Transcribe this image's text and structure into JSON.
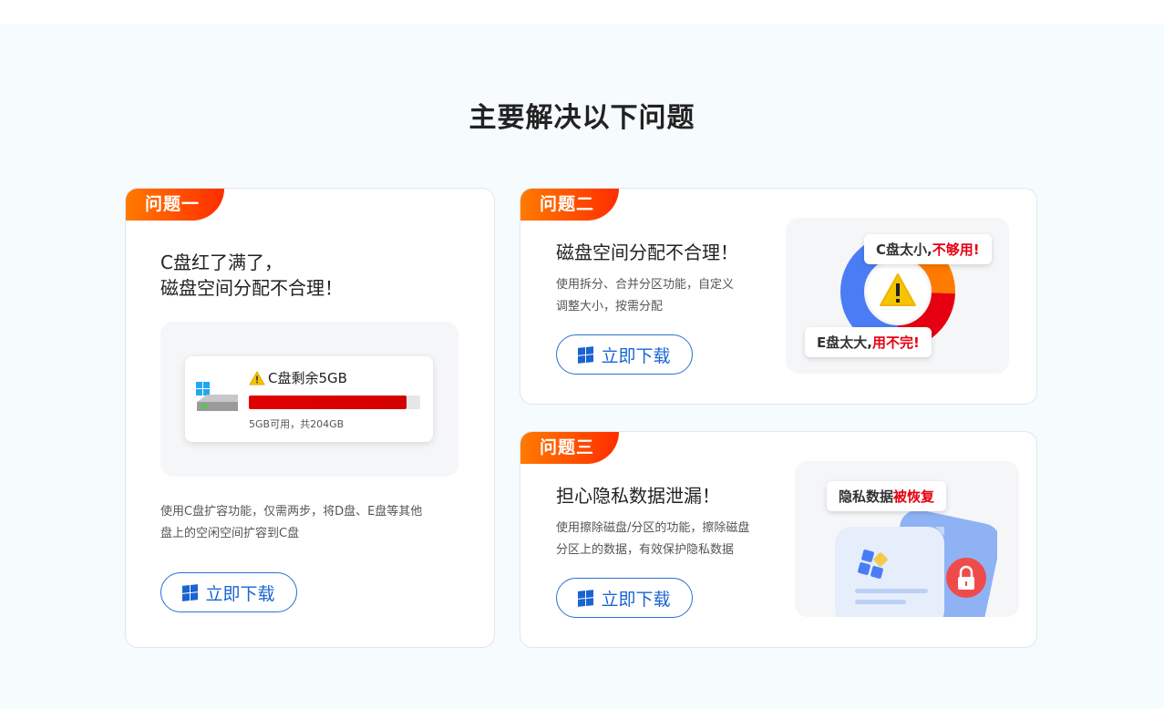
{
  "page": {
    "title": "主要解决以下问题"
  },
  "download_label": "立即下载",
  "colors": {
    "accent_blue": "#1a64d2",
    "badge_orange": "#ff7a00",
    "badge_red": "#ff2d00",
    "warning_red": "#e60012"
  },
  "cards": [
    {
      "badge": "问题一",
      "heading_line1": "C盘红了满了，",
      "heading_line2": "磁盘空间分配不合理！",
      "desc_line1": "使用C盘扩容功能，仅需两步，将D盘、E盘等其他",
      "desc_line2": "盘上的空闲空间扩容到C盘",
      "disk": {
        "label": "C盘剩余5GB",
        "info": "5GB可用，共204GB",
        "used_fraction": 0.92
      }
    },
    {
      "badge": "问题二",
      "heading": "磁盘空间分配不合理！",
      "desc_line1": "使用拆分、合并分区功能，自定义",
      "desc_line2": "调整大小，按需分配",
      "bubble_c_prefix": "C盘太小,",
      "bubble_c_red": "不够用!",
      "bubble_e_prefix": "E盘太大,",
      "bubble_e_red": "用不完!"
    },
    {
      "badge": "问题三",
      "heading": "担心隐私数据泄漏！",
      "desc_line1": "使用擦除磁盘/分区的功能，擦除磁盘",
      "desc_line2": "分区上的数据，有效保护隐私数据",
      "bubble_prefix": "隐私数据",
      "bubble_red": "被恢复"
    }
  ]
}
